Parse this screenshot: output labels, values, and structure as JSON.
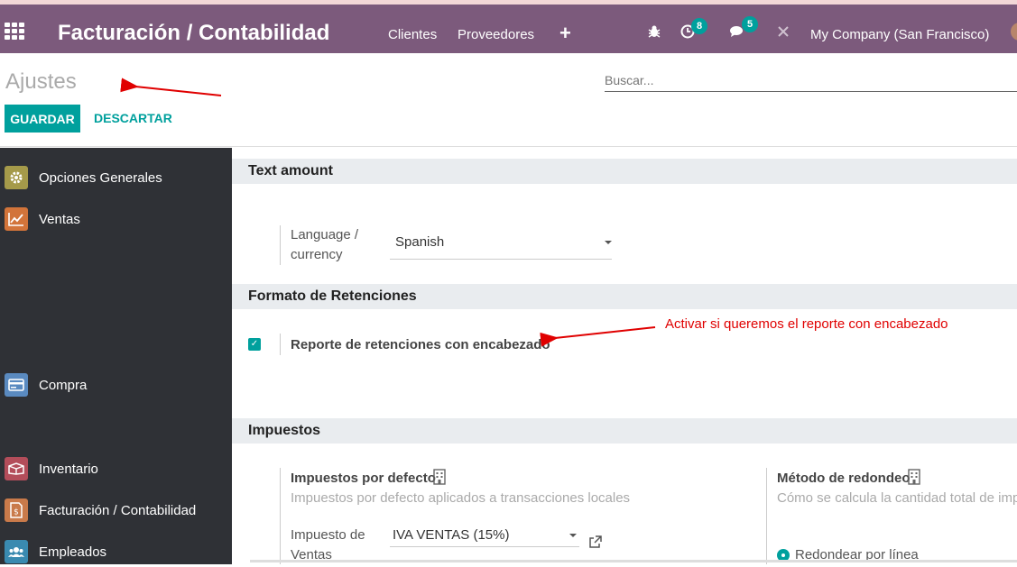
{
  "navbar": {
    "app_title": "Facturación / Contabilidad",
    "links": [
      "Clientes",
      "Proveedores"
    ],
    "activity_badge": "8",
    "messages_badge": "5",
    "company": "My Company (San Francisco)"
  },
  "control": {
    "breadcrumb": "Ajustes",
    "search_placeholder": "Buscar...",
    "save_label": "GUARDAR",
    "discard_label": "DESCARTAR"
  },
  "sidebar": {
    "items": [
      {
        "label": "Opciones Generales",
        "icon": "gear-icon",
        "color": "#a59a4a"
      },
      {
        "label": "Ventas",
        "icon": "chart-icon",
        "color": "#d2743a"
      },
      {
        "label": "Compra",
        "icon": "card-icon",
        "color": "#5a8ac0"
      },
      {
        "label": "Inventario",
        "icon": "box-icon",
        "color": "#b34d5a"
      },
      {
        "label": "Facturación / Contabilidad",
        "icon": "invoice-icon",
        "color": "#c97a4a"
      },
      {
        "label": "Empleados",
        "icon": "people-icon",
        "color": "#3a8ab0"
      }
    ]
  },
  "sections": {
    "text_amount": {
      "title": "Text amount",
      "language_label": "Language / currency",
      "language_value": "Spanish"
    },
    "retenciones": {
      "title": "Formato de Retenciones",
      "checkbox_label": "Reporte de retenciones con encabezado",
      "checked": true
    },
    "impuestos": {
      "title": "Impuestos",
      "default_title": "Impuestos por defecto",
      "default_desc": "Impuestos por defecto aplicados a transacciones locales",
      "sales_tax_label": "Impuesto de Ventas",
      "sales_tax_value": "IVA VENTAS (15%)",
      "rounding_title": "Método de redondeo",
      "rounding_desc": "Cómo se calcula la cantidad total de impuestos en órdenes y facturas",
      "rounding_option": "Redondear por línea"
    }
  },
  "annotation": "Activar si queremos el reporte con encabezado",
  "colors": {
    "navbar": "#7c5a7c",
    "accent": "#00a09d",
    "annotation": "#e00000"
  }
}
